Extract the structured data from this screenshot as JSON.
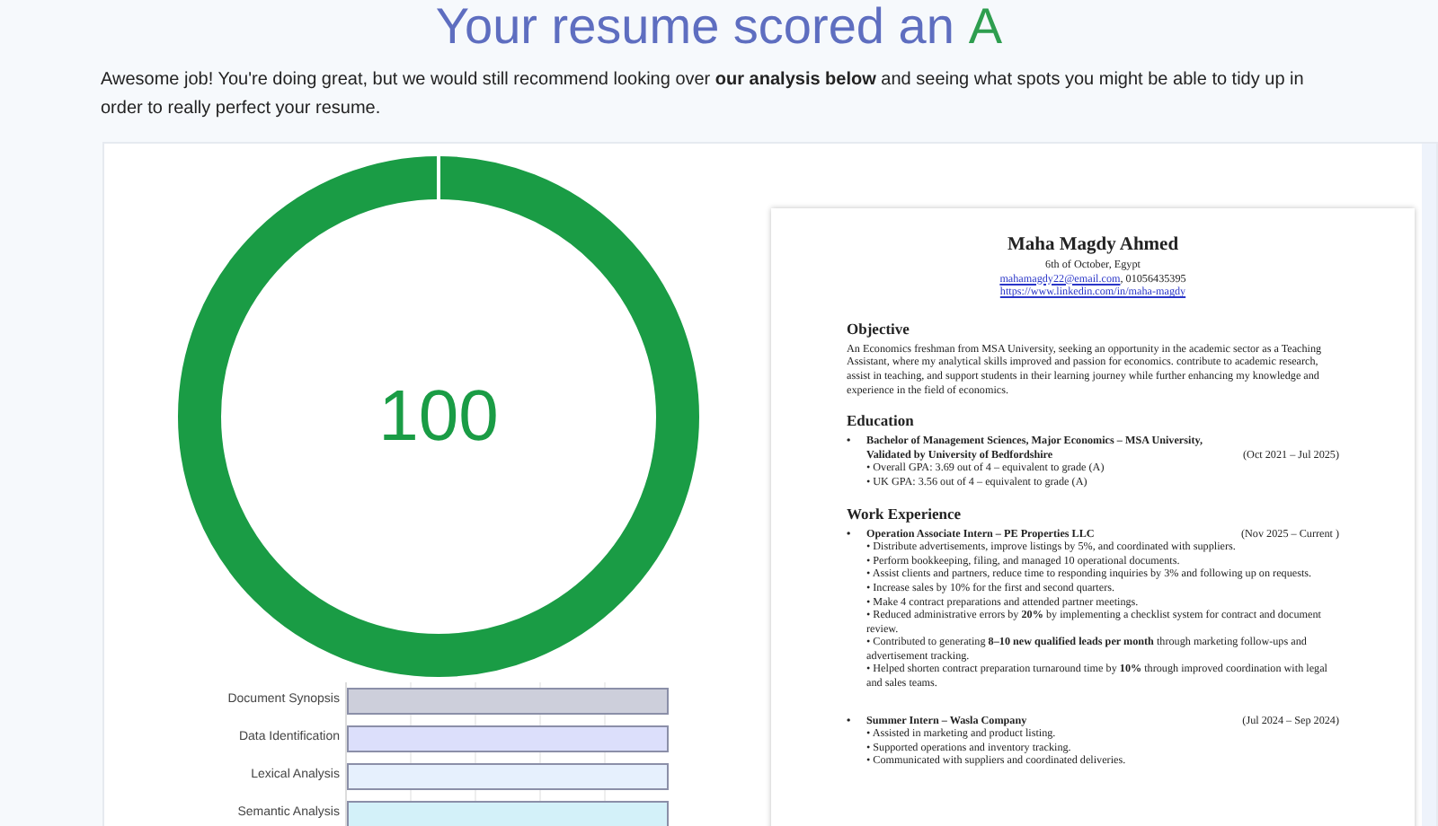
{
  "heading": {
    "text": "Your resume scored an",
    "grade": "A"
  },
  "intro": "Awesome job! You're doing great, but we would still recommend looking over **our analysis below** and seeing what spots you might be able to tidy up in order to really perfect your resume.",
  "score": {
    "value": "100",
    "level": 1
  },
  "bars": [
    {
      "label": "Document Synopsis",
      "color": "#cdcfdb",
      "level": 1
    },
    {
      "label": "Data Identification",
      "color": "#dcdffb",
      "level": 1
    },
    {
      "label": "Lexical Analysis",
      "color": "#e6f0fd",
      "level": 1
    },
    {
      "label": "Semantic Analysis",
      "color": "#d3f1f9",
      "level": 1
    }
  ],
  "resume": {
    "name": "Maha Magdy Ahmed",
    "location": "6th of October, Egypt",
    "email": "mahamagdy22@email.com",
    "phone": ", 01056435395",
    "linkedin": "https://www.linkedin.com/in/maha-magdy",
    "sections": [
      {
        "kind": "paragraph",
        "heading": "Objective",
        "text": "An Economics freshman from MSA University, seeking an opportunity in the academic sector as a Teaching Assistant, where my analytical skills improved and passion for economics. contribute to academic research, assist in teaching, and support students in their learning journey while further enhancing my knowledge and experience in the field of economics."
      },
      {
        "kind": "entries",
        "heading": "Education",
        "entries": [
          {
            "marker": "•",
            "title": "Bachelor of Management Sciences, Major Economics – MSA University, Validated by University of Bedfordshire",
            "dates": "(Oct 2021 – Jul 2025)",
            "bullets": [
              "• Overall GPA: 3.69 out of 4 – equivalent to grade (A)",
              "• UK GPA: 3.56 out of 4 – equivalent to grade (A)"
            ]
          }
        ]
      },
      {
        "kind": "entries",
        "heading": "Work Experience",
        "entries": [
          {
            "marker": "•",
            "title": "Operation Associate Intern – PE Properties LLC",
            "dates": "(Nov 2025 – Current )",
            "bullets": [
              "• Distribute advertisements, improve listings by 5%, and coordinated with suppliers.",
              "• Perform bookkeeping, filing, and managed 10 operational documents.",
              "• Assist clients and partners, reduce time to responding inquiries by 3% and following up on requests.",
              "• Increase sales by 10% for the first and second quarters.",
              "• Make 4 contract preparations and attended partner meetings.",
              "• Reduced administrative errors by **20%** by implementing a checklist system for contract and document review.",
              "• Contributed to generating **8–10 new qualified leads per month** through marketing follow-ups and advertisement tracking.",
              "• Helped shorten contract preparation turnaround time by **10%** through improved coordination with legal and sales teams."
            ]
          },
          {
            "marker": "•",
            "title": "Summer Intern – Wasla Company",
            "dates": "(Jul 2024 – Sep 2024)",
            "bullets": [
              "• Assisted in marketing and product listing.",
              "• Supported operations and inventory tracking.",
              "• Communicated with suppliers and coordinated deliveries."
            ]
          }
        ]
      }
    ]
  }
}
